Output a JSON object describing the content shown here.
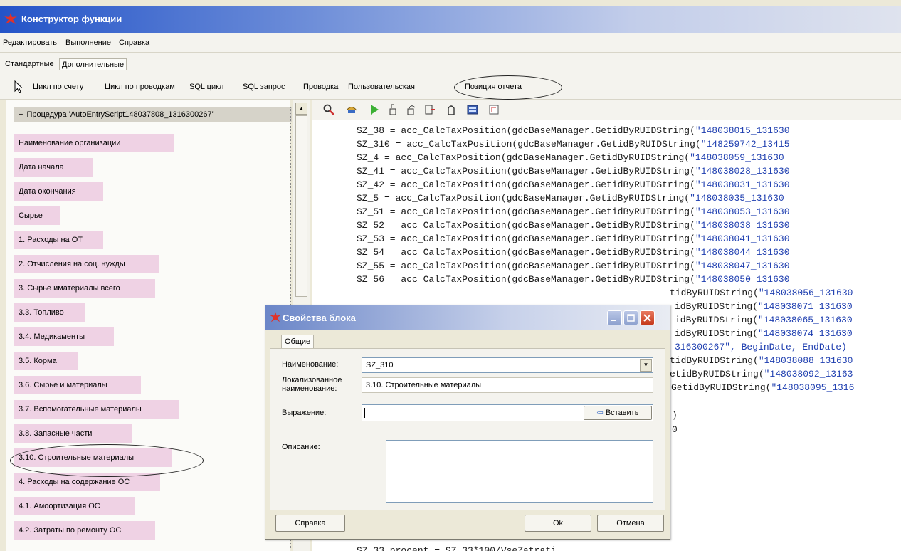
{
  "window": {
    "title": "Конструктор функции"
  },
  "menu": [
    "Редактировать",
    "Выполнение",
    "Справка"
  ],
  "tabs": [
    "Стандартные",
    "Дополнительные"
  ],
  "toolbar": {
    "items": [
      "Цикл по счету",
      "Цикл по проводкам",
      "SQL цикл",
      "SQL запрос",
      "Проводка",
      "Пользовательская",
      "Позиция отчета"
    ]
  },
  "tree": {
    "root": "Процедура 'AutoEntryScript148037808_1316300267'",
    "items": [
      "Наименование организации",
      "Дата начала",
      "Дата окончания",
      "Сырье",
      "1. Расходы на ОТ",
      "2. Отчисления на соц. нужды",
      "3. Сырье иматериалы всего",
      "3.3. Топливо",
      "3.4. Медикаменты",
      "3.5. Корма",
      "3.6. Сырье и материалы",
      "3.7. Вспомогательные материалы",
      "3.8. Запасные части",
      "3.10. Строительные материалы",
      "4. Расходы на содержание ОС",
      "4.1. Амоортизация ОС",
      "4.2. Затраты по ремонту ОС"
    ]
  },
  "code": {
    "lines": [
      {
        "text": "SZ_38 = acc_CalcTaxPosition(gdcBaseManager.GetidByRUIDString(",
        "str": "\"148038015_131630"
      },
      {
        "text": "SZ_310 = acc_CalcTaxPosition(gdcBaseManager.GetidByRUIDString(",
        "str": "\"148259742_13415"
      },
      {
        "text": "SZ_4 = acc_CalcTaxPosition(gdcBaseManager.GetidByRUIDString(",
        "str": "\"148038059_131630"
      },
      {
        "text": "SZ_41 = acc_CalcTaxPosition(gdcBaseManager.GetidByRUIDString(",
        "str": "\"148038028_131630"
      },
      {
        "text": "SZ_42 = acc_CalcTaxPosition(gdcBaseManager.GetidByRUIDString(",
        "str": "\"148038031_131630"
      },
      {
        "text": "SZ_5 = acc_CalcTaxPosition(gdcBaseManager.GetidByRUIDString(",
        "str": "\"148038035_131630"
      },
      {
        "text": "SZ_51 = acc_CalcTaxPosition(gdcBaseManager.GetidByRUIDString(",
        "str": "\"148038053_131630"
      },
      {
        "text": "SZ_52 = acc_CalcTaxPosition(gdcBaseManager.GetidByRUIDString(",
        "str": "\"148038038_131630"
      },
      {
        "text": "SZ_53 = acc_CalcTaxPosition(gdcBaseManager.GetidByRUIDString(",
        "str": "\"148038041_131630"
      },
      {
        "text": "SZ_54 = acc_CalcTaxPosition(gdcBaseManager.GetidByRUIDString(",
        "str": "\"148038044_131630"
      },
      {
        "text": "SZ_55 = acc_CalcTaxPosition(gdcBaseManager.GetidByRUIDString(",
        "str": "\"148038047_131630"
      },
      {
        "text": "SZ_56 = acc_CalcTaxPosition(gdcBaseManager.GetidByRUIDString(",
        "str": "\"148038050_131630"
      }
    ],
    "partial": [
      {
        "text": "tidByRUIDString(",
        "str": "\"148038056_131630"
      },
      {
        "text": "idByRUIDString(",
        "str": "\"148038071_131630"
      },
      {
        "text": "idByRUIDString(",
        "str": "\"148038065_131630"
      },
      {
        "text": "idByRUIDString(",
        "str": "\"148038074_131630"
      },
      {
        "text": "",
        "str": "316300267\", BeginDate, EndDate)"
      },
      {
        "text": "tidByRUIDString(",
        "str": "\"148038088_131630"
      },
      {
        "text": "etidByRUIDString(",
        "str": "\"148038092_13163"
      },
      {
        "text": "GetidByRUIDString(",
        "str": "\"148038095_1316"
      }
    ],
    "fragment_1": ")",
    "fragment_2": "0",
    "bottom_line": "SZ_33_procent = SZ_33*100/VseZatrati"
  },
  "dialog": {
    "title": "Свойства блока",
    "tab": "Общие",
    "name_label": "Наименование:",
    "name_value": "SZ_310",
    "localized_label_1": "Локализованное",
    "localized_label_2": "наименование:",
    "localized_value": "3.10. Строительные материалы",
    "expression_label": "Выражение:",
    "expression_value": "",
    "insert_button": "Вставить",
    "description_label": "Описание:",
    "help_button": "Справка",
    "ok_button": "Ok",
    "cancel_button": "Отмена"
  },
  "colors": {
    "tree_item_bg": "#efd2e4",
    "code_string": "#1f3fb0",
    "titlebar_start": "#2454c8",
    "close_button": "#c53a1c"
  }
}
